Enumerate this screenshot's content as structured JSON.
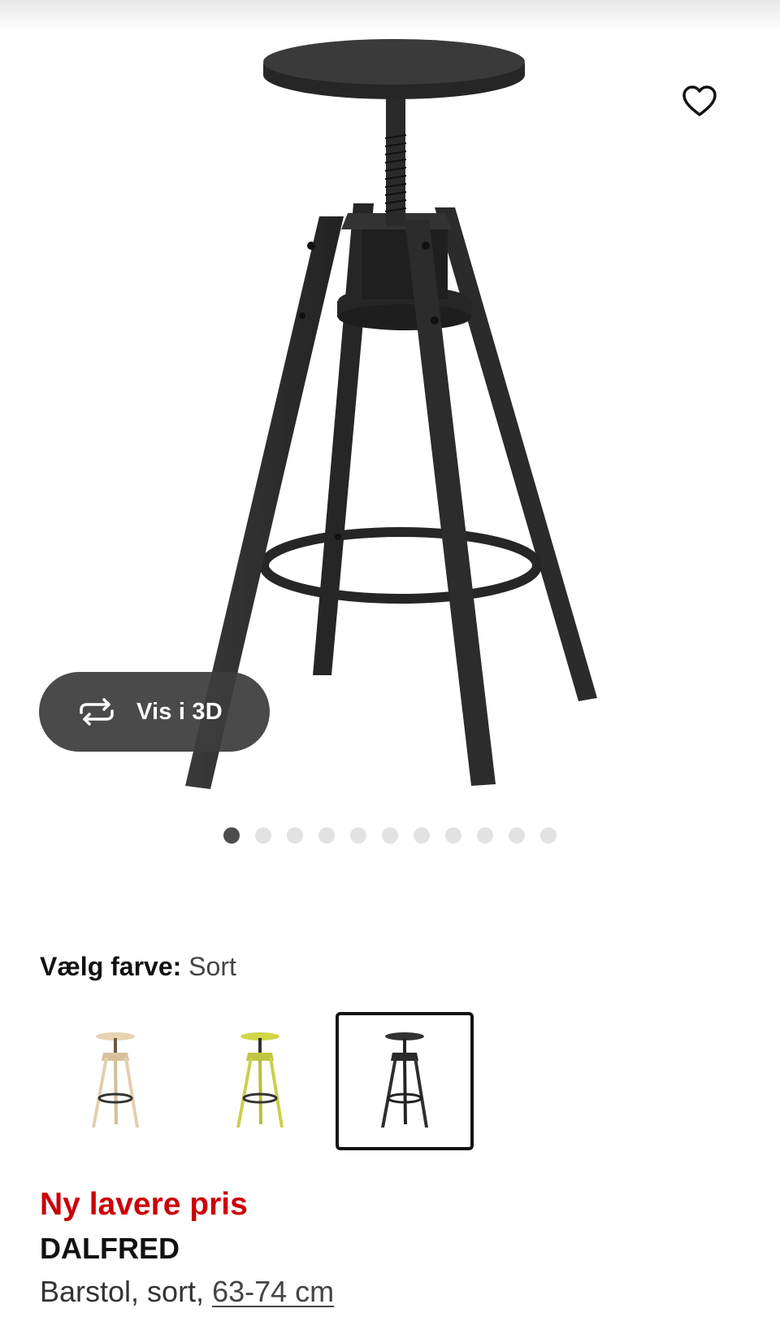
{
  "product_image": {
    "alt": "DALFRED Barstol, sort"
  },
  "favorite": {
    "icon": "heart-outline-icon"
  },
  "view_3d": {
    "label": "Vis i 3D",
    "icon": "rotate-3d-icon"
  },
  "carousel": {
    "total": 11,
    "active": 1
  },
  "color_picker": {
    "label": "Vælg farve:",
    "selected": "Sort",
    "options": [
      {
        "color": "birch",
        "selected": false
      },
      {
        "color": "yellow",
        "selected": false
      },
      {
        "color": "black",
        "selected": true
      }
    ]
  },
  "product": {
    "promo": "Ny lavere pris",
    "name": "DALFRED",
    "description": "Barstol, sort, ",
    "size": "63-74 cm"
  },
  "colors": {
    "promo_red": "#cc0008",
    "text": "#111111",
    "stool_black": "#2e2e2e",
    "birch": "#e6d3b3",
    "yellow": "#cfd64a"
  }
}
